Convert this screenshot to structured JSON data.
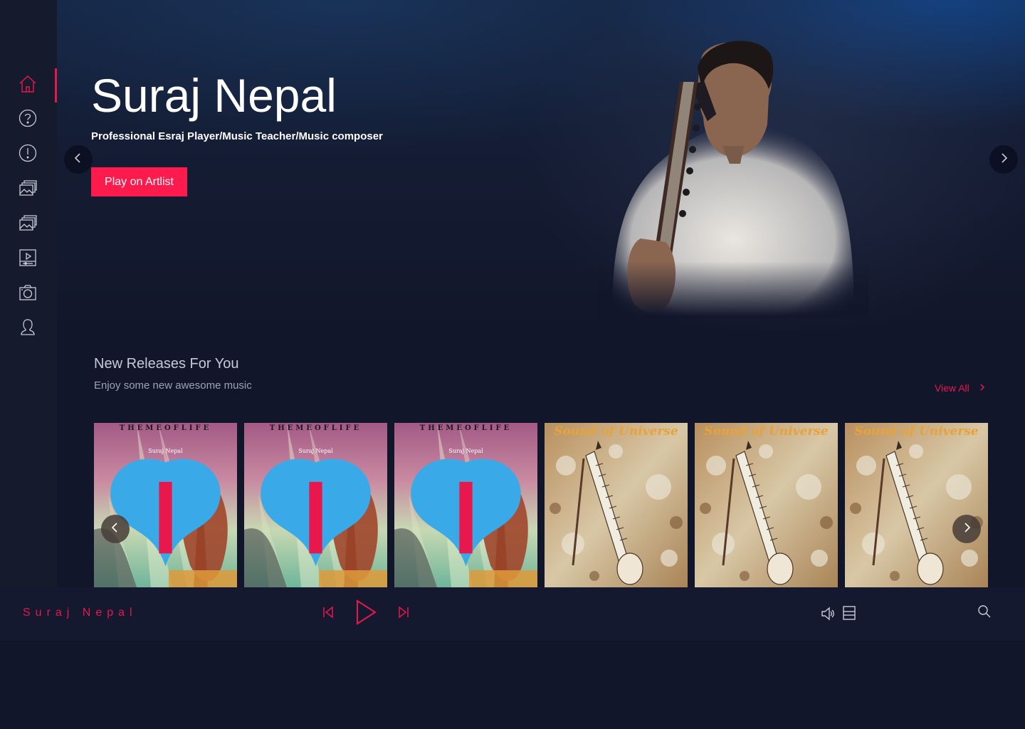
{
  "sidebar": {
    "items": [
      {
        "name": "home",
        "icon": "home-icon",
        "active": true
      },
      {
        "name": "help",
        "icon": "question-icon",
        "active": false
      },
      {
        "name": "info",
        "icon": "alert-icon",
        "active": false
      },
      {
        "name": "albums",
        "icon": "gallery-icon",
        "active": false
      },
      {
        "name": "collections",
        "icon": "gallery-icon",
        "active": false
      },
      {
        "name": "videos",
        "icon": "video-icon",
        "active": false
      },
      {
        "name": "photos",
        "icon": "camera-icon",
        "active": false
      },
      {
        "name": "profile",
        "icon": "user-icon",
        "active": false
      }
    ]
  },
  "hero": {
    "title": "Suraj Nepal",
    "subtitle": "Professional Esraj Player/Music Teacher/Music composer",
    "button_label": "Play on Artlist"
  },
  "releases": {
    "title": "New Releases For You",
    "subtitle": "Enjoy some new awesome music",
    "view_all_label": "View All",
    "albums": [
      {
        "style": "themeoflife",
        "title": "THEMEOFLIFE",
        "artist": "Suraj Nepal"
      },
      {
        "style": "themeoflife",
        "title": "THEMEOFLIFE",
        "artist": "Suraj Nepal"
      },
      {
        "style": "themeoflife",
        "title": "THEMEOFLIFE",
        "artist": "Suraj Nepal"
      },
      {
        "style": "universe",
        "title": "Sound of Universe"
      },
      {
        "style": "universe",
        "title": "Sound of Universe"
      },
      {
        "style": "universe",
        "title": "Sound of Universe"
      }
    ]
  },
  "player": {
    "artist": "Suraj Nepal"
  },
  "colors": {
    "accent": "#e8184c",
    "button": "#fd1a4d",
    "background": "#12162a",
    "sidebar": "#151a2d"
  }
}
